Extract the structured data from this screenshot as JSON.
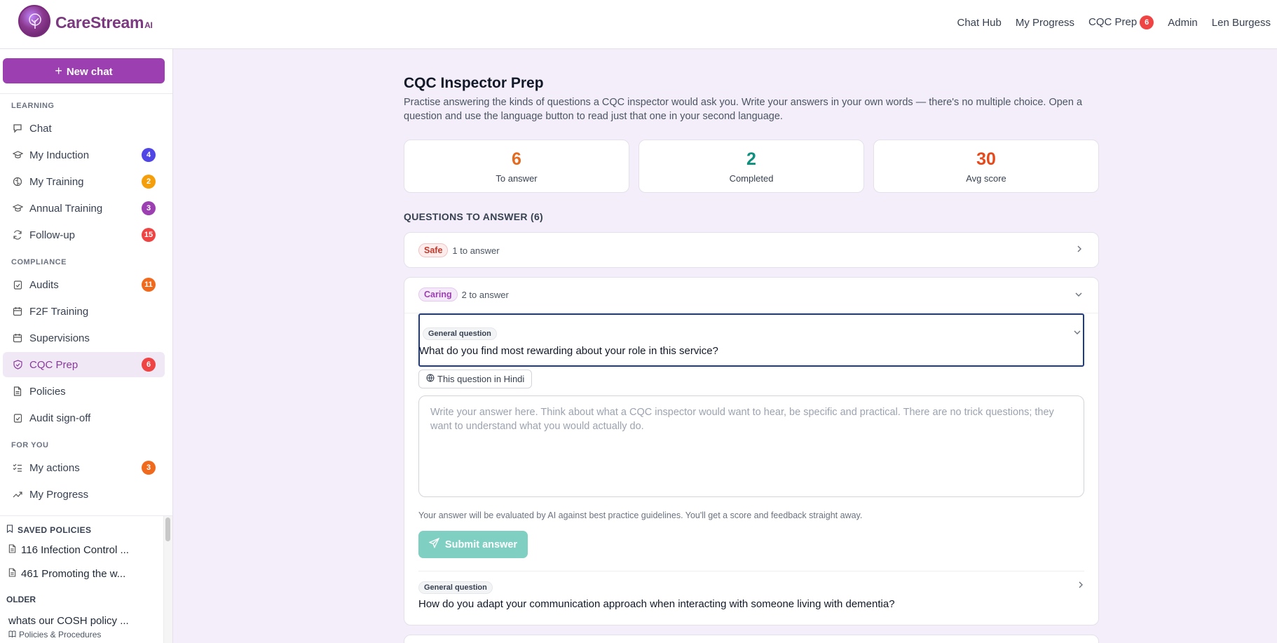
{
  "header": {
    "brand": "CareStream",
    "brand_suffix": "AI",
    "nav": [
      "Chat Hub",
      "My Progress",
      "CQC Prep",
      "Admin",
      "Len Burgess"
    ],
    "cqc_badge": "6"
  },
  "sidebar": {
    "new_chat": "New chat",
    "sections": {
      "learning": "LEARNING",
      "compliance": "COMPLIANCE",
      "for_you": "FOR YOU"
    },
    "items": [
      {
        "label": "Chat",
        "badge": ""
      },
      {
        "label": "My Induction",
        "badge": "4"
      },
      {
        "label": "My Training",
        "badge": "2"
      },
      {
        "label": "Annual Training",
        "badge": "3"
      },
      {
        "label": "Follow-up",
        "badge": "15"
      },
      {
        "label": "Audits",
        "badge": "11"
      },
      {
        "label": "F2F Training",
        "badge": ""
      },
      {
        "label": "Supervisions",
        "badge": ""
      },
      {
        "label": "CQC Prep",
        "badge": "6"
      },
      {
        "label": "Policies",
        "badge": ""
      },
      {
        "label": "Audit sign-off",
        "badge": ""
      },
      {
        "label": "My actions",
        "badge": "3"
      },
      {
        "label": "My Progress",
        "badge": ""
      }
    ],
    "saved_title": "SAVED POLICIES",
    "saved": [
      "116 Infection Control ...",
      "461 Promoting the w..."
    ],
    "older_title": "OLDER",
    "older_chat": "whats our COSH policy ...",
    "older_chat_sub": "Policies & Procedures"
  },
  "main": {
    "title": "CQC Inspector Prep",
    "description": "Practise answering the kinds of questions a CQC inspector would ask you. Write your answers in your own words — there's no multiple choice. Open a question and use the language button to read just that one in your second language.",
    "stats": [
      {
        "value": "6",
        "label": "To answer",
        "color": "#e36a1e"
      },
      {
        "value": "2",
        "label": "Completed",
        "color": "#0f8f7e"
      },
      {
        "value": "30",
        "label": "Avg score",
        "color": "#e34b1e"
      }
    ],
    "questions_heading": "QUESTIONS TO ANSWER (6)",
    "groups": [
      {
        "tag": "Safe",
        "count": "1 to answer"
      },
      {
        "tag": "Caring",
        "count": "2 to answer"
      }
    ],
    "question_tag": "General question",
    "open_question": "What do you find most rewarding about your role in this service?",
    "language_button": "This question in Hindi",
    "answer_placeholder": "Write your answer here. Think about what a CQC inspector would want to hear, be specific and practical. There are no trick questions; they want to understand what you would actually do.",
    "hint": "Your answer will be evaluated by AI against best practice guidelines. You'll get a score and feedback straight away.",
    "submit": "Submit answer",
    "next_question": "How do you adapt your communication approach when interacting with someone living with dementia?"
  },
  "colors": {
    "brand_purple": "#9b3fb1",
    "badge_blue": "#4f46e5",
    "badge_orange": "#f59e0b",
    "badge_purple": "#9b3fb1",
    "badge_red": "#ef4444",
    "badge_deep_orange": "#f06a1e",
    "submit_teal": "#7fcfc3"
  }
}
